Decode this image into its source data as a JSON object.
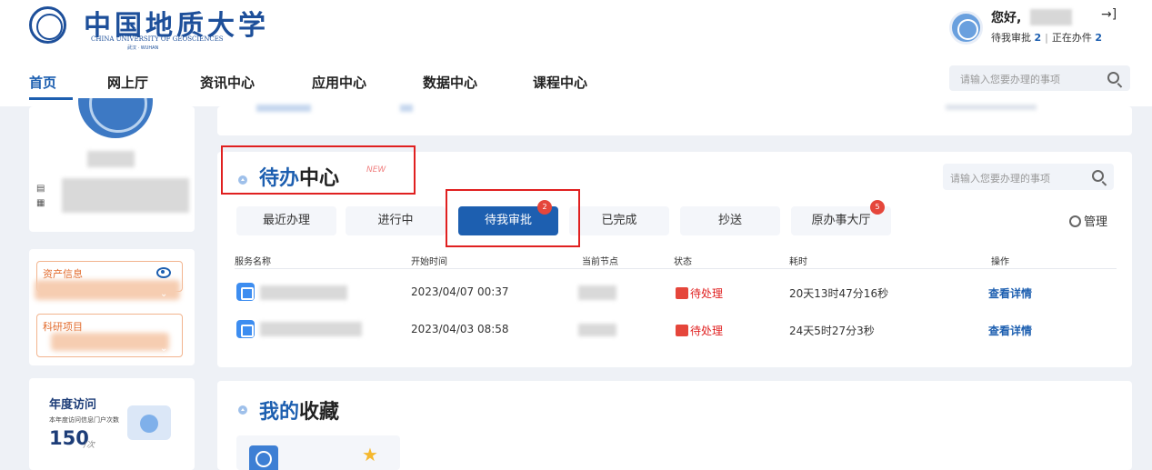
{
  "header": {
    "logo_cn": "中国地质大学",
    "logo_en": "CHINA UNIVERSITY OF GEOSCIENCES",
    "logo_sub": "武汉 · WUHAN",
    "greeting": "您好,",
    "stats_pending_label": "待我审批",
    "stats_pending_count": "2",
    "stats_inprogress_label": "正在办件",
    "stats_inprogress_count": "2",
    "search_placeholder": "请输入您要办理的事项"
  },
  "nav": {
    "items": [
      {
        "label": "首页"
      },
      {
        "label": "网上厅"
      },
      {
        "label": "资讯中心"
      },
      {
        "label": "应用中心"
      },
      {
        "label": "数据中心"
      },
      {
        "label": "课程中心"
      }
    ],
    "active": "首页"
  },
  "sidebar": {
    "asset_label": "资产信息",
    "research_label": "科研项目",
    "visit_title": "年度访问",
    "visit_desc": "本年度访问信息门户次数",
    "visit_count": "150",
    "visit_unit": "/次"
  },
  "todo": {
    "title_part1": "待办",
    "title_part2": "中心",
    "new_badge": "NEW",
    "search_placeholder": "请输入您要办理的事项",
    "tabs": [
      {
        "label": "最近办理"
      },
      {
        "label": "进行中"
      },
      {
        "label": "待我审批",
        "badge": "2"
      },
      {
        "label": "已完成"
      },
      {
        "label": "抄送"
      },
      {
        "label": "原办事大厅",
        "badge": "5"
      }
    ],
    "active_tab": "待我审批",
    "manage_label": "管理",
    "columns": [
      "服务名称",
      "开始时间",
      "当前节点",
      "状态",
      "耗时",
      "操作"
    ],
    "rows": [
      {
        "start": "2023/04/07 00:37",
        "status": "待处理",
        "duration": "20天13时47分16秒",
        "action": "查看详情"
      },
      {
        "start": "2023/04/03 08:58",
        "status": "待处理",
        "duration": "24天5时27分3秒",
        "action": "查看详情"
      }
    ]
  },
  "favorites": {
    "title_part1": "我的",
    "title_part2": "收藏"
  },
  "colors": {
    "accent": "#1d5fb0",
    "brand": "#1d4f9a",
    "status_red": "#e02020",
    "highlight_box": "#e02020"
  }
}
